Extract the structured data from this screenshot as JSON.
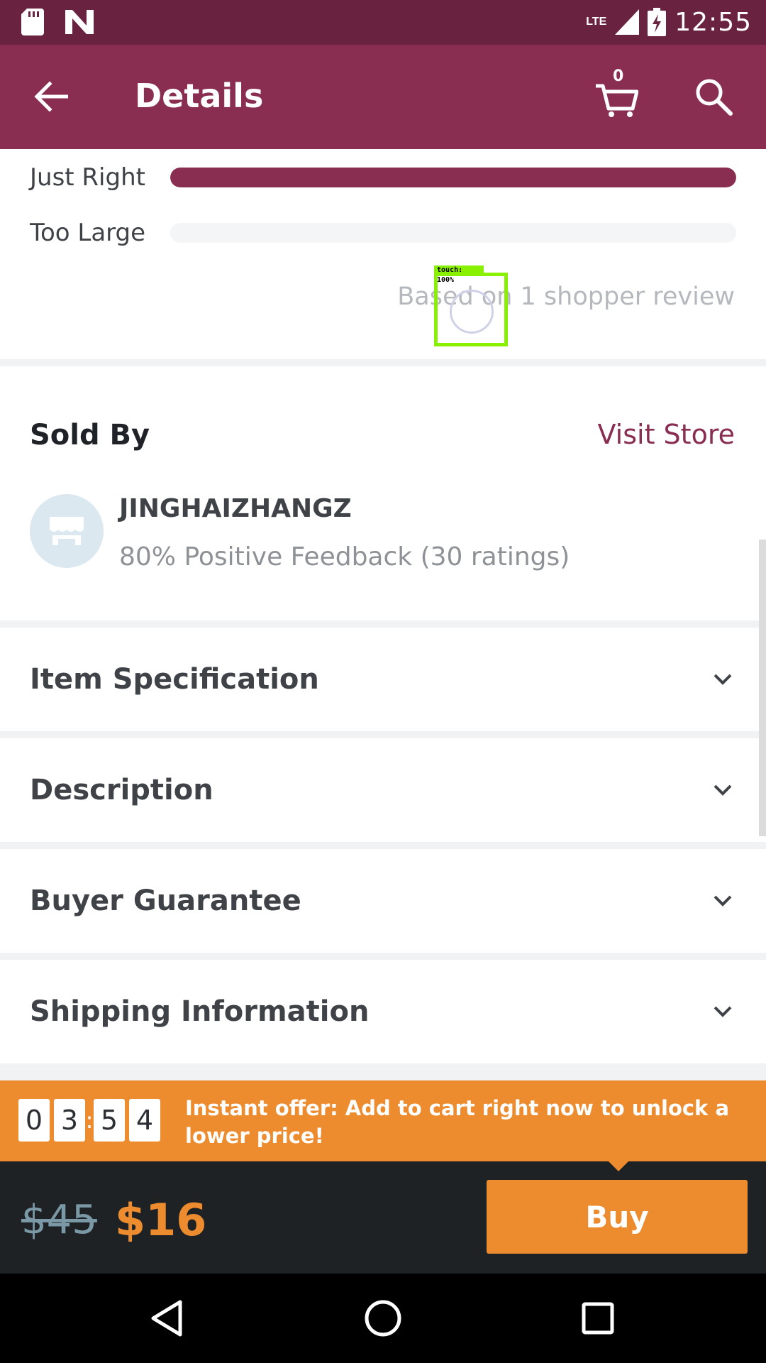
{
  "status_bar": {
    "time": "12:55",
    "network": "LTE",
    "icons": [
      "sd-card-icon",
      "n-notification-icon",
      "signal-icon",
      "battery-charging-icon"
    ]
  },
  "app_bar": {
    "title": "Details",
    "cart_count": "0",
    "icons": [
      "back-arrow-icon",
      "cart-icon",
      "search-icon"
    ]
  },
  "fit": {
    "rows": [
      {
        "label": "Just Right",
        "fraction": 1.0
      },
      {
        "label": "Too Large",
        "fraction": 0.0
      }
    ],
    "review_note": "Based on 1 shopper review"
  },
  "touch_overlay": {
    "label": "touch: 100%"
  },
  "sold_by": {
    "title": "Sold By",
    "visit_store": "Visit Store",
    "store_name": "JINGHAIZHANGZ",
    "feedback": "80% Positive Feedback (30 ratings)",
    "avatar_icon": "storefront-icon"
  },
  "accordion": [
    {
      "label": "Item Specification"
    },
    {
      "label": "Description"
    },
    {
      "label": "Buyer Guarantee"
    },
    {
      "label": "Shipping Information"
    }
  ],
  "offer": {
    "timer": [
      "0",
      "3",
      "5",
      "4"
    ],
    "separator": ":",
    "text": "Instant offer: Add to cart right now to unlock a lower price!"
  },
  "price": {
    "original": "$45",
    "current": "$16",
    "buy_label": "Buy"
  },
  "colors": {
    "status_bar": "#6a2241",
    "brand": "#892d51",
    "accent": "#ed8b2f",
    "bottom_bar": "#1e2225"
  },
  "nav_bar": {
    "icons": [
      "back-triangle-icon",
      "home-circle-icon",
      "recents-square-icon"
    ]
  }
}
